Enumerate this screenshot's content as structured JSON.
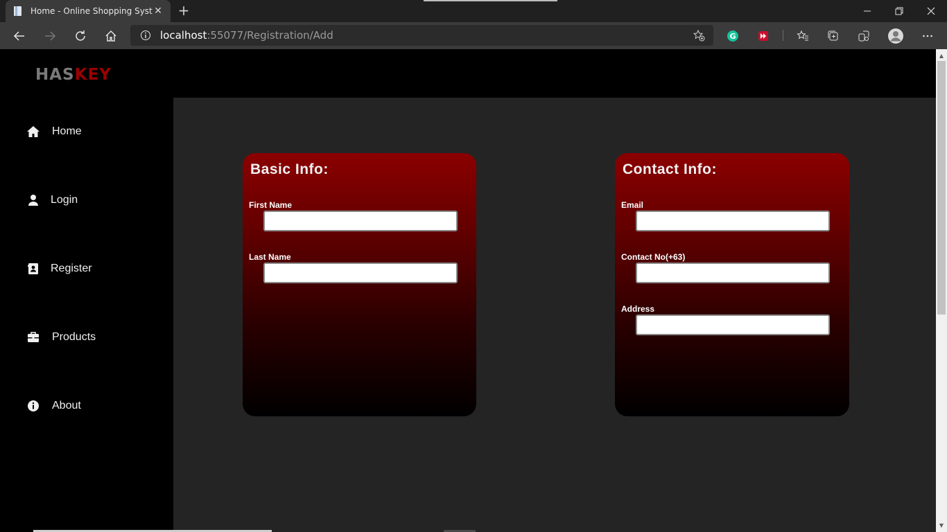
{
  "browser": {
    "tab_title": "Home - Online Shopping System",
    "tab_close": "✕",
    "new_tab": "+",
    "url_host": "localhost",
    "url_path": ":55077/Registration/Add",
    "window_minimize": "—",
    "window_restore": "❐",
    "window_close": "✕"
  },
  "site": {
    "logo_part1": "HAS",
    "logo_part2": "KEY"
  },
  "sidebar": {
    "items": [
      {
        "label": "Home",
        "icon": "home-icon"
      },
      {
        "label": "Login",
        "icon": "user-icon"
      },
      {
        "label": "Register",
        "icon": "contact-card-icon"
      },
      {
        "label": "Products",
        "icon": "briefcase-icon"
      },
      {
        "label": "About",
        "icon": "info-icon"
      }
    ]
  },
  "basic_info": {
    "heading": "Basic Info:",
    "fields": [
      {
        "label": "First Name",
        "value": ""
      },
      {
        "label": "Last Name",
        "value": ""
      }
    ]
  },
  "contact_info": {
    "heading": "Contact Info:",
    "fields": [
      {
        "label": "Email",
        "value": ""
      },
      {
        "label": "Contact No(+63)",
        "value": ""
      },
      {
        "label": "Address",
        "value": ""
      }
    ]
  },
  "colors": {
    "logo_grey": "#7a7a7a",
    "logo_red": "#9b0000",
    "card_top": "#8b0000",
    "main_bg": "#242424"
  }
}
